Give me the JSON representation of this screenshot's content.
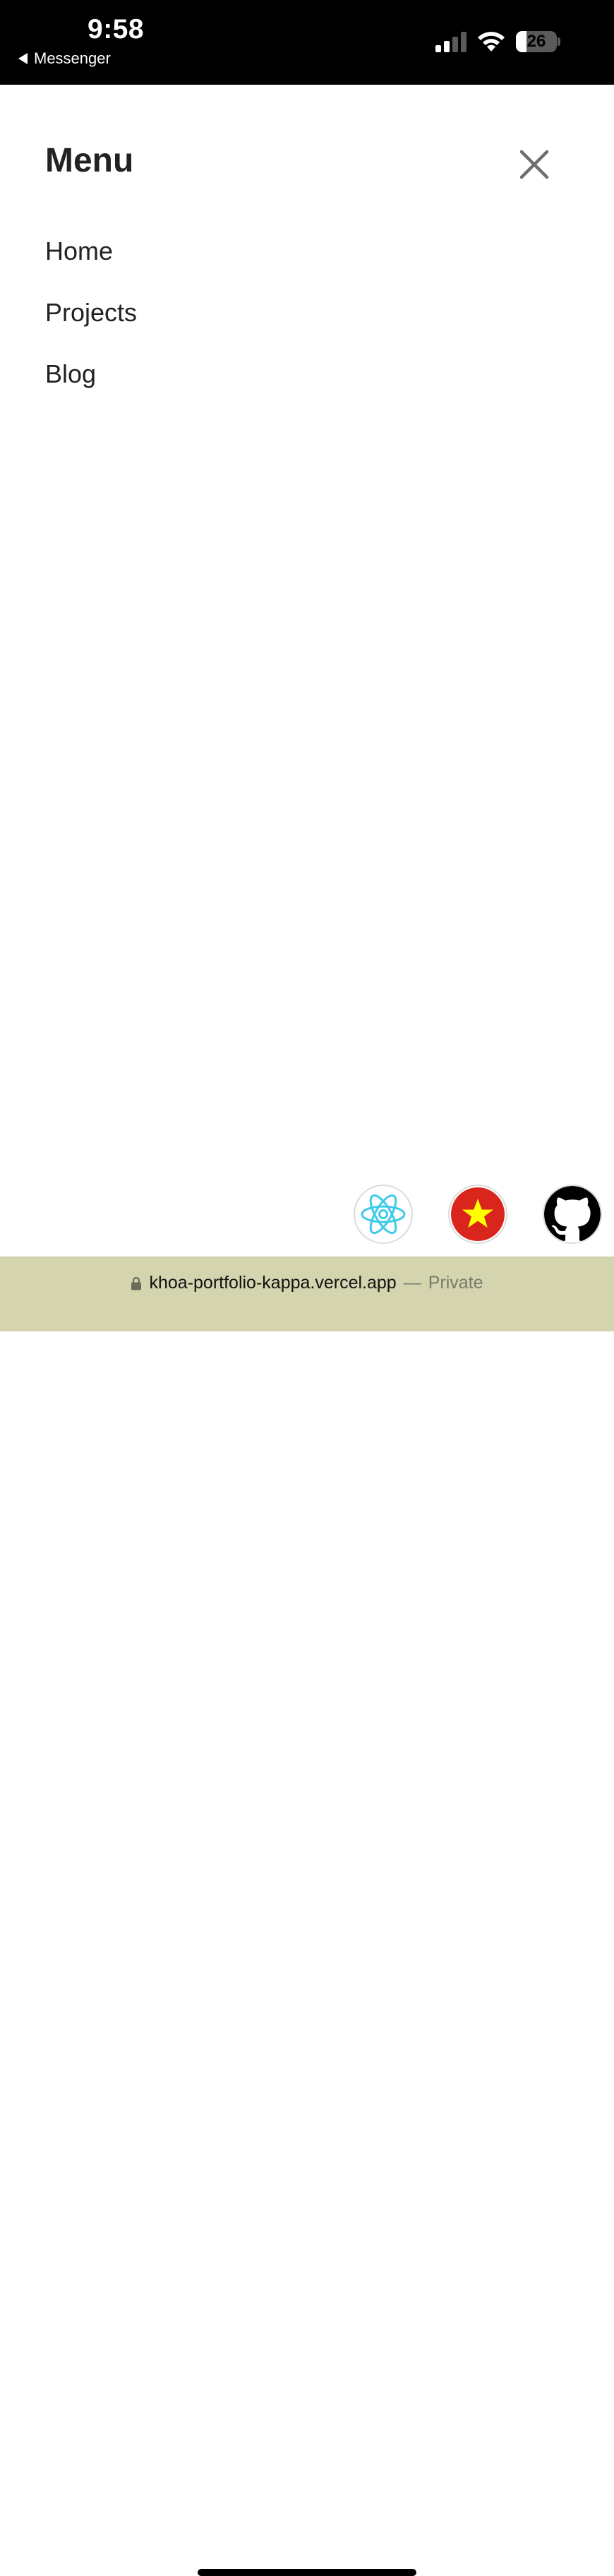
{
  "status_bar": {
    "time": "9:58",
    "back_app": "Messenger",
    "battery_level": "26",
    "battery_fraction": 0.26
  },
  "menu": {
    "title": "Menu",
    "close_icon": "close-icon",
    "items": [
      {
        "label": "Home"
      },
      {
        "label": "Projects"
      },
      {
        "label": "Blog"
      }
    ]
  },
  "floating_links": [
    {
      "icon": "react-icon",
      "color": "#61dafb"
    },
    {
      "icon": "vietnam-flag-icon",
      "color": "#da251d"
    },
    {
      "icon": "github-icon",
      "color": "#000000"
    }
  ],
  "browser": {
    "url": "khoa-portfolio-kappa.vercel.app",
    "separator": "—",
    "mode": "Private"
  }
}
